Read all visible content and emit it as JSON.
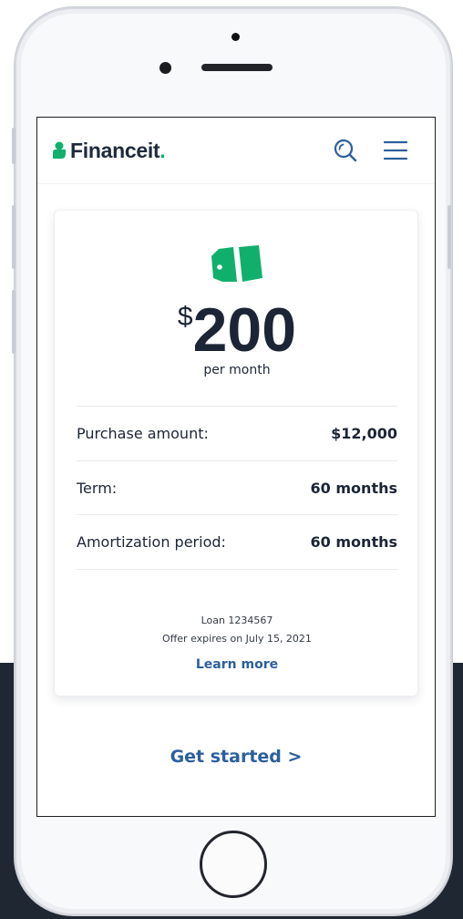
{
  "brand": {
    "name": "Financeit",
    "dot": ".",
    "accent_color": "#10b06c",
    "link_color": "#2c5f9e",
    "text_color": "#1c2536"
  },
  "header": {
    "search_icon": "search-icon",
    "menu_icon": "hamburger-menu-icon"
  },
  "offer": {
    "icon": "price-tag-icon",
    "currency_symbol": "$",
    "monthly_amount": "200",
    "per_month_label": "per month",
    "details": [
      {
        "label": "Purchase amount:",
        "value": "$12,000"
      },
      {
        "label": "Term:",
        "value": "60 months"
      },
      {
        "label": "Amortization period:",
        "value": "60 months"
      }
    ],
    "loan_label": "Loan 1234567",
    "expires_label": "Offer expires on July 15, 2021",
    "learn_more": "Learn more"
  },
  "cta": {
    "get_started": "Get started >"
  }
}
